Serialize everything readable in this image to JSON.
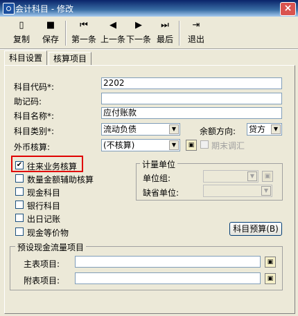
{
  "window": {
    "title": "会计科目 - 修改",
    "close_glyph": "×"
  },
  "toolbar": {
    "copy": "复制",
    "save": "保存",
    "first": "第一条",
    "prev": "上一条",
    "next": "下一条",
    "last": "最后",
    "exit": "退出"
  },
  "tabs": [
    "科目设置",
    "核算项目"
  ],
  "form": {
    "code_label": "科目代码*:",
    "code_value": "2202",
    "mnemonic_label": "助记码:",
    "mnemonic_value": "",
    "name_label": "科目名称*:",
    "name_value": "应付账款",
    "category_label": "科目类别*:",
    "category_value": "流动负债",
    "balance_label": "余额方向:",
    "balance_value": "贷方",
    "currency_label": "外币核算:",
    "currency_value": "(不核算)",
    "period_adjust_label": "期末调汇"
  },
  "checkboxes": [
    {
      "label": "往来业务核算",
      "checked": true
    },
    {
      "label": "数量金额辅助核算",
      "checked": false
    },
    {
      "label": "现金科目",
      "checked": false
    },
    {
      "label": "银行科目",
      "checked": false
    },
    {
      "label": "出日记账",
      "checked": false
    },
    {
      "label": "现金等价物",
      "checked": false
    }
  ],
  "unit_group": {
    "title": "计量单位",
    "group_label": "单位组:",
    "default_label": "缺省单位:"
  },
  "budget_button": "科目预算(B)",
  "cashflow": {
    "title": "预设现金流量项目",
    "main_label": "主表项目:",
    "sub_label": "附表项目:"
  },
  "colors": {
    "highlight_border": "#e00000",
    "title_bar": "#0a246a"
  }
}
